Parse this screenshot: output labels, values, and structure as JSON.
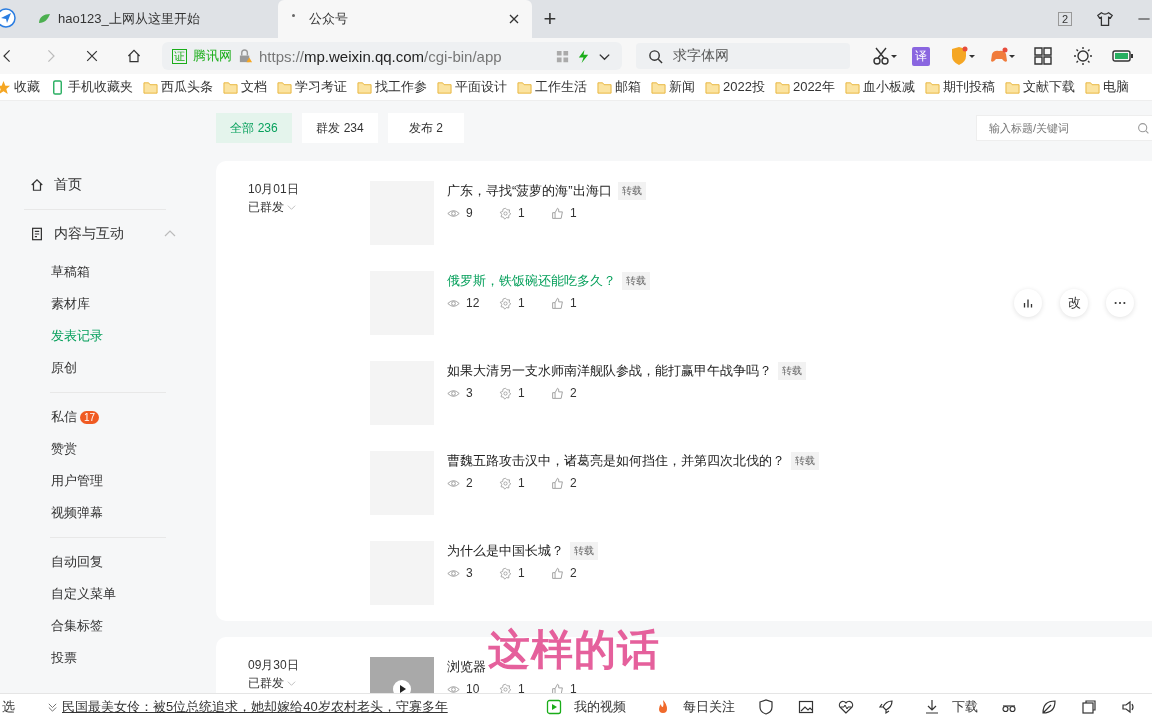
{
  "browser": {
    "tabs": [
      {
        "title": "hao123_上网从这里开始",
        "selected": false
      },
      {
        "title": "公众号",
        "selected": true
      }
    ],
    "new_tab": "+",
    "tab_count": "2",
    "address": {
      "cert": "证",
      "site": "腾讯网",
      "url_host_prefix": "https://",
      "url_host": "mp.weixin.qq.com",
      "url_path": "/cgi-bin/app"
    },
    "search": {
      "value": "求字体网"
    },
    "translate": "译",
    "bookmarks": [
      {
        "label": "收藏",
        "kind": "star"
      },
      {
        "label": "手机收藏夹",
        "kind": "phone"
      },
      {
        "label": "西瓜头条",
        "kind": "folder"
      },
      {
        "label": "文档",
        "kind": "folder"
      },
      {
        "label": "学习考证",
        "kind": "folder"
      },
      {
        "label": "找工作参",
        "kind": "folder"
      },
      {
        "label": "平面设计",
        "kind": "folder"
      },
      {
        "label": "工作生活",
        "kind": "folder"
      },
      {
        "label": "邮箱",
        "kind": "folder"
      },
      {
        "label": "新闻",
        "kind": "folder"
      },
      {
        "label": "2022投",
        "kind": "folder"
      },
      {
        "label": "2022年",
        "kind": "folder"
      },
      {
        "label": "血小板减",
        "kind": "folder"
      },
      {
        "label": "期刊投稿",
        "kind": "folder"
      },
      {
        "label": "文献下载",
        "kind": "folder"
      },
      {
        "label": "电脑",
        "kind": "folder"
      }
    ]
  },
  "sidebar": {
    "items": [
      {
        "label": "首页",
        "kind": "home"
      },
      {
        "label": "内容与互动",
        "kind": "section",
        "expanded": true,
        "children": [
          {
            "label": "草稿箱",
            "selected": false
          },
          {
            "label": "素材库",
            "selected": false
          },
          {
            "label": "发表记录",
            "selected": true
          },
          {
            "label": "原创",
            "selected": false
          }
        ]
      },
      {
        "label": "私信",
        "kind": "item",
        "badge": "17"
      },
      {
        "label": "赞赏",
        "kind": "item"
      },
      {
        "label": "用户管理",
        "kind": "item"
      },
      {
        "label": "视频弹幕",
        "kind": "item"
      },
      {
        "label": "自动回复",
        "kind": "item",
        "divider_before": true
      },
      {
        "label": "自定义菜单",
        "kind": "item"
      },
      {
        "label": "合集标签",
        "kind": "item"
      },
      {
        "label": "投票",
        "kind": "item"
      }
    ]
  },
  "filters": [
    {
      "label": "全部 236",
      "selected": true
    },
    {
      "label": "群发 234",
      "selected": false
    },
    {
      "label": "发布 2",
      "selected": false
    }
  ],
  "search_box": {
    "placeholder": "输入标题/关键词"
  },
  "groups": [
    {
      "date": "10月01日",
      "status": "已群发",
      "articles": [
        {
          "kind": "text",
          "title": "广东，寻找“菠萝的海”出海口",
          "tag": "转载",
          "views": "9",
          "shares": "1",
          "likes": "1",
          "hovered": false
        },
        {
          "kind": "text",
          "title": "俄罗斯，铁饭碗还能吃多久？",
          "tag": "转载",
          "views": "12",
          "shares": "1",
          "likes": "1",
          "hovered": true,
          "actions": [
            "改"
          ]
        },
        {
          "kind": "text",
          "title": "如果大清另一支水师南洋舰队参战，能打赢甲午战争吗？",
          "tag": "转载",
          "views": "3",
          "shares": "1",
          "likes": "2",
          "hovered": false
        },
        {
          "kind": "text",
          "title": "曹魏五路攻击汉中，诸葛亮是如何挡住，并第四次北伐的？",
          "tag": "转载",
          "views": "2",
          "shares": "1",
          "likes": "2",
          "hovered": false
        },
        {
          "kind": "text",
          "title": "为什么是中国长城？",
          "tag": "转载",
          "views": "3",
          "shares": "1",
          "likes": "2",
          "hovered": false
        }
      ]
    },
    {
      "date": "09月30日",
      "status": "已群发",
      "articles": [
        {
          "kind": "video",
          "title": "浏览器",
          "views": "10",
          "shares": "1",
          "likes": "1",
          "hovered": false
        }
      ]
    }
  ],
  "subtitle": "这样的话",
  "status_bar": {
    "left": "选",
    "news": "民国最美女伶：被5位总统追求，她却嫁给40岁农村老头，守寡多年",
    "items": [
      {
        "label": "我的视频",
        "kind": "video"
      },
      {
        "label": "每日关注",
        "kind": "fire"
      },
      {
        "label": "下载",
        "kind": "download"
      }
    ]
  }
}
